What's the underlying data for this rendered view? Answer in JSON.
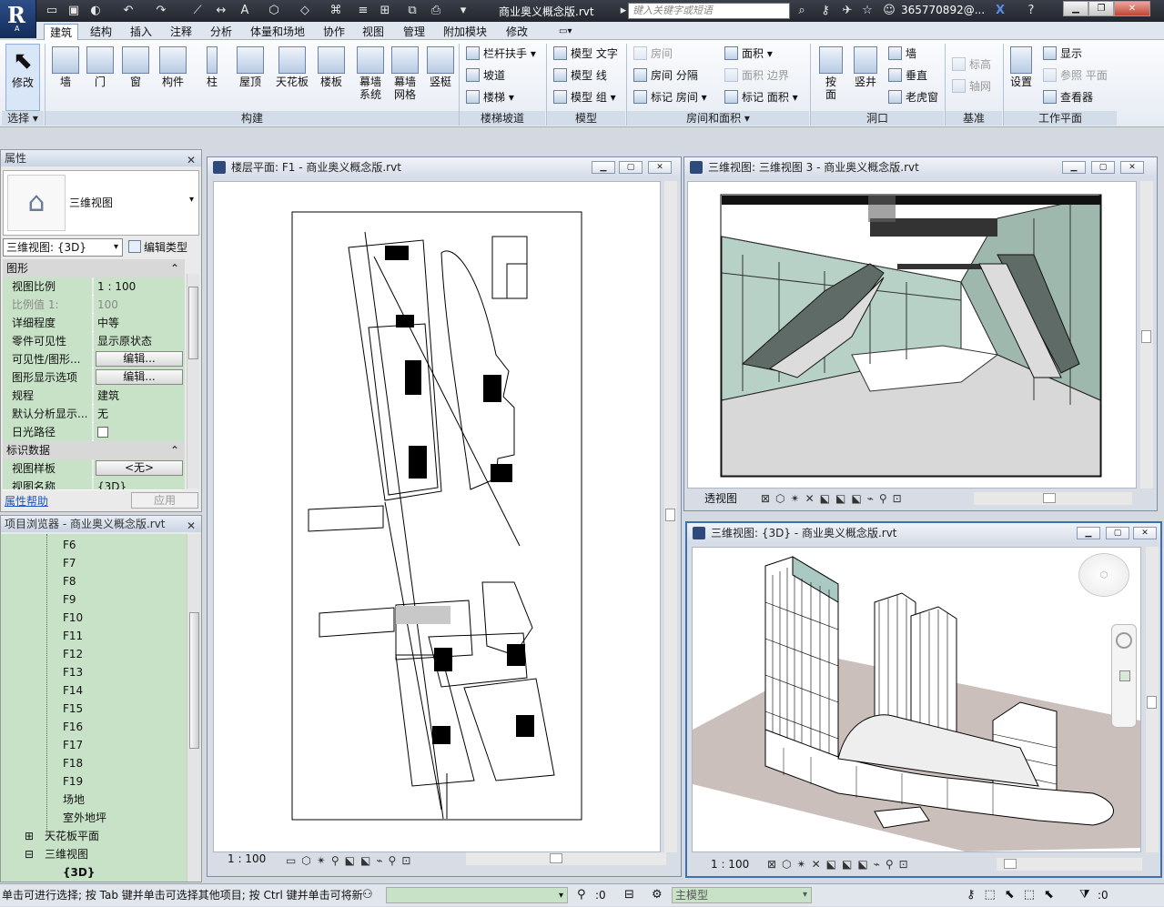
{
  "title_bar": {
    "doc_title": "商业奥义概念版.rvt",
    "search_placeholder": "键入关键字或短语",
    "user": "365770892@...",
    "app_letter": "R",
    "app_sub": "A"
  },
  "tabs": [
    "建筑",
    "结构",
    "插入",
    "注释",
    "分析",
    "体量和场地",
    "协作",
    "视图",
    "管理",
    "附加模块",
    "修改"
  ],
  "ribbon": {
    "select_label": "修改",
    "select_panel": "选择",
    "build_buttons": [
      "墙",
      "门",
      "窗",
      "构件",
      "柱",
      "屋顶",
      "天花板",
      "楼板",
      "幕墙系统",
      "幕墙网格",
      "竖梃"
    ],
    "build_panel": "构建",
    "stair_items": [
      "栏杆扶手",
      "坡道",
      "楼梯"
    ],
    "stair_panel": "楼梯坡道",
    "model_items": [
      "模型 文字",
      "模型 线",
      "模型 组"
    ],
    "model_panel": "模型",
    "room_items": [
      "房间",
      "房间 分隔",
      "标记 房间",
      "面积",
      "面积 边界",
      "标记 面积"
    ],
    "room_panel": "房间和面积",
    "opening_items": [
      "按面",
      "竖井",
      "墙",
      "垂直",
      "老虎窗"
    ],
    "opening_panel": "洞口",
    "datum_items": [
      "标高",
      "轴网"
    ],
    "datum_panel": "基准",
    "wp_items": [
      "设置",
      "显示",
      "参照 平面",
      "查看器"
    ],
    "wp_panel": "工作平面"
  },
  "properties": {
    "header": "属性",
    "type_name": "三维视图",
    "selector": "三维视图: {3D}",
    "edit_type": "编辑类型",
    "group_graphics": "图形",
    "rows": [
      {
        "k": "视图比例",
        "v": "1 : 100"
      },
      {
        "k": "比例值 1:",
        "v": "100"
      },
      {
        "k": "详细程度",
        "v": "中等"
      },
      {
        "k": "零件可见性",
        "v": "显示原状态"
      },
      {
        "k": "可见性/图形...",
        "v": "编辑..."
      },
      {
        "k": "图形显示选项",
        "v": "编辑..."
      },
      {
        "k": "规程",
        "v": "建筑"
      },
      {
        "k": "默认分析显示...",
        "v": "无"
      },
      {
        "k": "日光路径",
        "v": ""
      }
    ],
    "group_id": "标识数据",
    "rows2": [
      {
        "k": "视图样板",
        "v": "<无>"
      },
      {
        "k": "视图名称",
        "v": "{3D}"
      }
    ],
    "help_link": "属性帮助",
    "apply": "应用"
  },
  "browser": {
    "header": "项目浏览器 - 商业奥义概念版.rvt",
    "levels": [
      "F6",
      "F7",
      "F8",
      "F9",
      "F10",
      "F11",
      "F12",
      "F13",
      "F14",
      "F15",
      "F16",
      "F17",
      "F18",
      "F19",
      "场地",
      "室外地坪"
    ],
    "ceiling": "天花板平面",
    "views3d": "三维视图",
    "current": "{3D}"
  },
  "views": {
    "floor": {
      "title": "楼层平面: F1 - 商业奥义概念版.rvt",
      "scale": "1 : 100"
    },
    "persp": {
      "title": "三维视图: 三维视图 3 - 商业奥义概念版.rvt",
      "status": "透视图"
    },
    "iso": {
      "title": "三维视图: {3D} - 商业奥义概念版.rvt",
      "scale": "1 : 100"
    }
  },
  "statusbar": {
    "hint": "单击可进行选择; 按 Tab 键并单击可选择其他项目; 按 Ctrl 键并单击可将新",
    "zero": ":0",
    "model": "主模型",
    "zero2": ":0"
  }
}
